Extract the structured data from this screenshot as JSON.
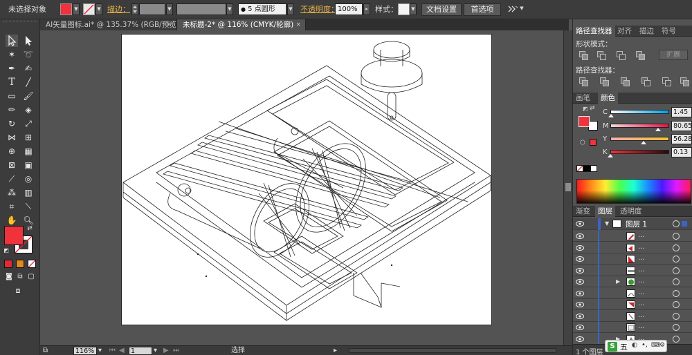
{
  "control_bar": {
    "selection_status": "未选择对象",
    "stroke_label": "描边：",
    "brush_size_label": "5",
    "brush_type_label": "点圆形",
    "opacity_label": "不透明度：",
    "opacity_value": "100%",
    "style_label": "样式：",
    "document_setup_button": "文档设置",
    "preferences_button": "首选项",
    "fill_color": "#f0323c"
  },
  "document_tabs": [
    {
      "label": "AI矢量图标.ai* @ 135.37% (RGB/预览)",
      "close": "×"
    },
    {
      "label": "未标题-2* @ 116% (CMYK/轮廓)",
      "close": "×"
    }
  ],
  "toolbox": {
    "fill_color": "#f0323c",
    "stroke_color": "#ffffff",
    "mini_swatches": [
      "#e0283a",
      "#e08a1e",
      "#ffffff"
    ]
  },
  "status_bar": {
    "zoom_value": "116%",
    "page_value": "1",
    "tool_status": "选择"
  },
  "right_panel": {
    "pathfinder_tabs": [
      "路径查找器",
      "对齐",
      "描边",
      "符号"
    ],
    "shape_modes_label": "形状模式：",
    "expand_button": "扩展",
    "pathfinders_label": "路径查找器：",
    "color_tabs": [
      "画笔",
      "颜色"
    ],
    "cmyk": [
      {
        "letter": "C",
        "value": "1.45",
        "pct": 0.0145
      },
      {
        "letter": "M",
        "value": "80.65",
        "pct": 0.8065
      },
      {
        "letter": "Y",
        "value": "56.28",
        "pct": 0.5628
      },
      {
        "letter": "K",
        "value": "0.13",
        "pct": 0.0013
      }
    ],
    "layer_tabs": [
      "渐变",
      "图层",
      "透明度"
    ],
    "layer_name": "图层 1",
    "sublayer_dots": "...",
    "layers_count": "1 个图层"
  },
  "overlay": {
    "ime_label": "五"
  }
}
